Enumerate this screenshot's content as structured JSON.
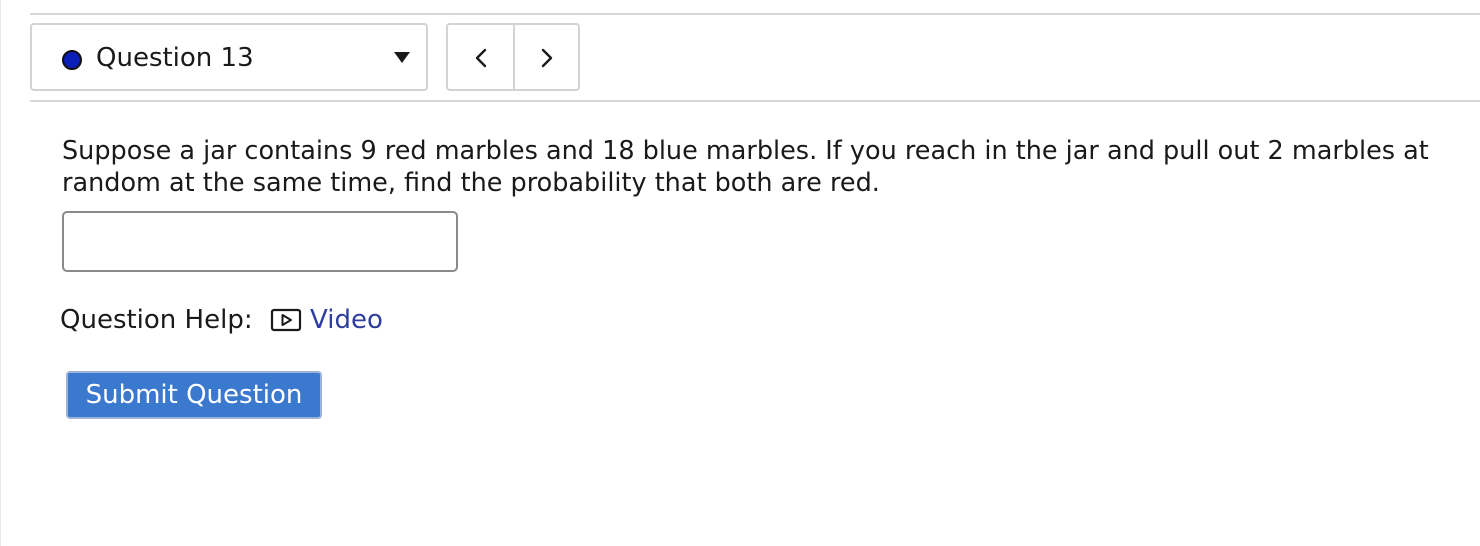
{
  "question_nav": {
    "select_label": "Question 13",
    "status_color": "#0b1fb8",
    "prev_icon": "chevron-left-icon",
    "next_icon": "chevron-right-icon",
    "dropdown_icon": "caret-down-icon"
  },
  "question": {
    "text": "Suppose a jar contains 9 red marbles and 18 blue marbles. If you reach in the jar and pull out 2 marbles at random at the same time, find the probability that both are red."
  },
  "answer": {
    "value": "",
    "placeholder": ""
  },
  "help": {
    "label": "Question Help:",
    "video_icon": "video-play-icon",
    "video_label": "Video",
    "link_color": "#2f3e9e"
  },
  "submit": {
    "label": "Submit Question",
    "color": "#3b79cf"
  }
}
